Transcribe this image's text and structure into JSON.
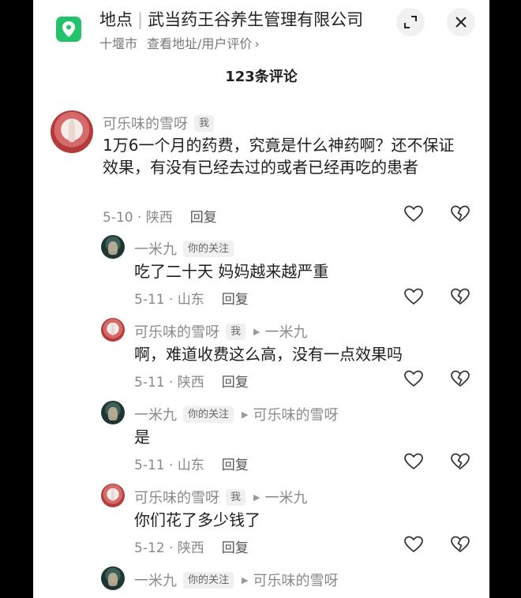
{
  "location": {
    "label": "地点",
    "name": "武当药王谷养生管理有限公司",
    "city": "十堰市",
    "link_text": "查看地址/用户评价",
    "chevron": "›"
  },
  "comments_title": "123条评论",
  "comments": [
    {
      "user": "可乐味的雪呀",
      "tag": "我",
      "target": "",
      "text": "1万6一个月的药费，究竟是什么神药啊？还不保证效果，有没有已经去过的或者已经再吃的患者",
      "date": "5-10 · 陕西",
      "reply": "回复"
    },
    {
      "user": "一米九",
      "tag": "你的关注",
      "target": "",
      "text": "吃了二十天 妈妈越来越严重",
      "date": "5-11 · 山东",
      "reply": "回复"
    },
    {
      "user": "可乐味的雪呀",
      "tag": "我",
      "target": "一米九",
      "text": "啊，难道收费这么高，没有一点效果吗",
      "date": "5-11 · 陕西",
      "reply": "回复"
    },
    {
      "user": "一米九",
      "tag": "你的关注",
      "target": "可乐味的雪呀",
      "text": "是",
      "date": "5-11 · 山东",
      "reply": "回复"
    },
    {
      "user": "可乐味的雪呀",
      "tag": "我",
      "target": "一米九",
      "text": "你们花了多少钱了",
      "date": "5-12 · 陕西",
      "reply": "回复"
    },
    {
      "user": "一米九",
      "tag": "你的关注",
      "target": "可乐味的雪呀",
      "text": "",
      "date": "",
      "reply": ""
    }
  ],
  "icons": {
    "location": "map-pin-icon",
    "shrink": "minimize-icon",
    "close": "close-icon",
    "like": "heart-icon",
    "dislike": "broken-heart-icon",
    "reply_arrow": "play-arrow-icon"
  },
  "colors": {
    "accent": "#22c36a",
    "meta": "#888888",
    "text": "#1e1e1e"
  }
}
